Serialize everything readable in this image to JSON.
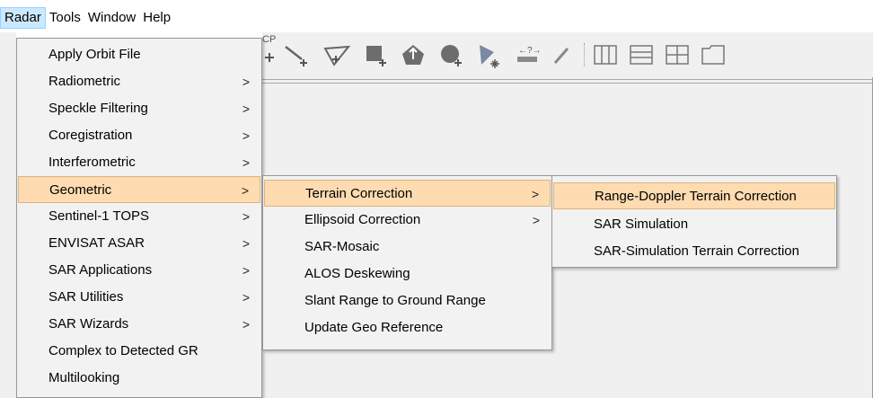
{
  "menubar": {
    "items": [
      {
        "label": "Radar",
        "active": true
      },
      {
        "label": "Tools"
      },
      {
        "label": "Window"
      },
      {
        "label": "Help"
      }
    ]
  },
  "toolbar": {
    "partial_label": "CP",
    "icons": [
      "add-point-icon",
      "draw-line-icon",
      "draw-polyline-icon",
      "add-rectangle-icon",
      "pan-shape-icon",
      "add-ellipse-icon",
      "magic-wand-icon",
      "range-finder-icon",
      "pin-tool-icon",
      "tile-vertical-icon",
      "tile-horizontal-icon",
      "tile-grid-icon",
      "tile-window-icon"
    ]
  },
  "radar_menu": {
    "items": [
      {
        "label": "Apply Orbit File",
        "submenu": false
      },
      {
        "label": "Radiometric",
        "submenu": true
      },
      {
        "label": "Speckle Filtering",
        "submenu": true
      },
      {
        "label": "Coregistration",
        "submenu": true
      },
      {
        "label": "Interferometric",
        "submenu": true
      },
      {
        "label": "Geometric",
        "submenu": true,
        "highlighted": true
      },
      {
        "label": "Sentinel-1 TOPS",
        "submenu": true
      },
      {
        "label": "ENVISAT ASAR",
        "submenu": true
      },
      {
        "label": "SAR Applications",
        "submenu": true
      },
      {
        "label": "SAR Utilities",
        "submenu": true
      },
      {
        "label": "SAR Wizards",
        "submenu": true
      },
      {
        "label": "Complex to Detected GR",
        "submenu": false
      },
      {
        "label": "Multilooking",
        "submenu": false
      }
    ]
  },
  "geometric_menu": {
    "items": [
      {
        "label": "Terrain Correction",
        "submenu": true,
        "highlighted": true
      },
      {
        "label": "Ellipsoid Correction",
        "submenu": true
      },
      {
        "label": "SAR-Mosaic",
        "submenu": false
      },
      {
        "label": "ALOS Deskewing",
        "submenu": false
      },
      {
        "label": "Slant Range to Ground Range",
        "submenu": false
      },
      {
        "label": "Update Geo Reference",
        "submenu": false
      }
    ]
  },
  "terrain_menu": {
    "items": [
      {
        "label": "Range-Doppler Terrain Correction",
        "highlighted": true
      },
      {
        "label": "SAR Simulation"
      },
      {
        "label": "SAR-Simulation Terrain Correction"
      }
    ]
  },
  "arrow_glyph": ">",
  "colors": {
    "highlight_bg": "#fedbb0",
    "highlight_border": "#dcb67a",
    "menu_bg": "#f2f2f2",
    "active_menubar": "#cce8ff"
  }
}
